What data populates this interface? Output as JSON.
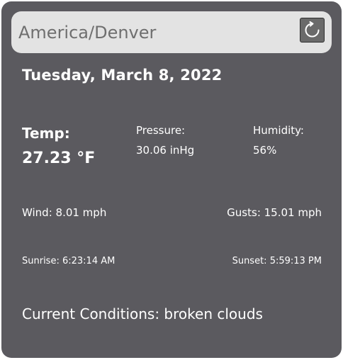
{
  "search": {
    "value": "America/Denver"
  },
  "refresh_icon": "refresh-icon",
  "date": "Tuesday, March 8, 2022",
  "temp": {
    "label": "Temp:",
    "value": "27.23 °F"
  },
  "pressure": {
    "label": "Pressure:",
    "value": "30.06 inHg"
  },
  "humidity": {
    "label": "Humidity:",
    "value": "56%"
  },
  "wind": "Wind: 8.01 mph",
  "gusts": "Gusts: 15.01 mph",
  "sunrise": "Sunrise: 6:23:14 AM",
  "sunset": "Sunset: 5:59:13 PM",
  "conditions": "Current Conditions: broken clouds",
  "colors": {
    "card_background": "#5b5a5f",
    "search_background": "#e3e3e3",
    "text": "#ffffff",
    "input_text": "#6f6f6f"
  }
}
